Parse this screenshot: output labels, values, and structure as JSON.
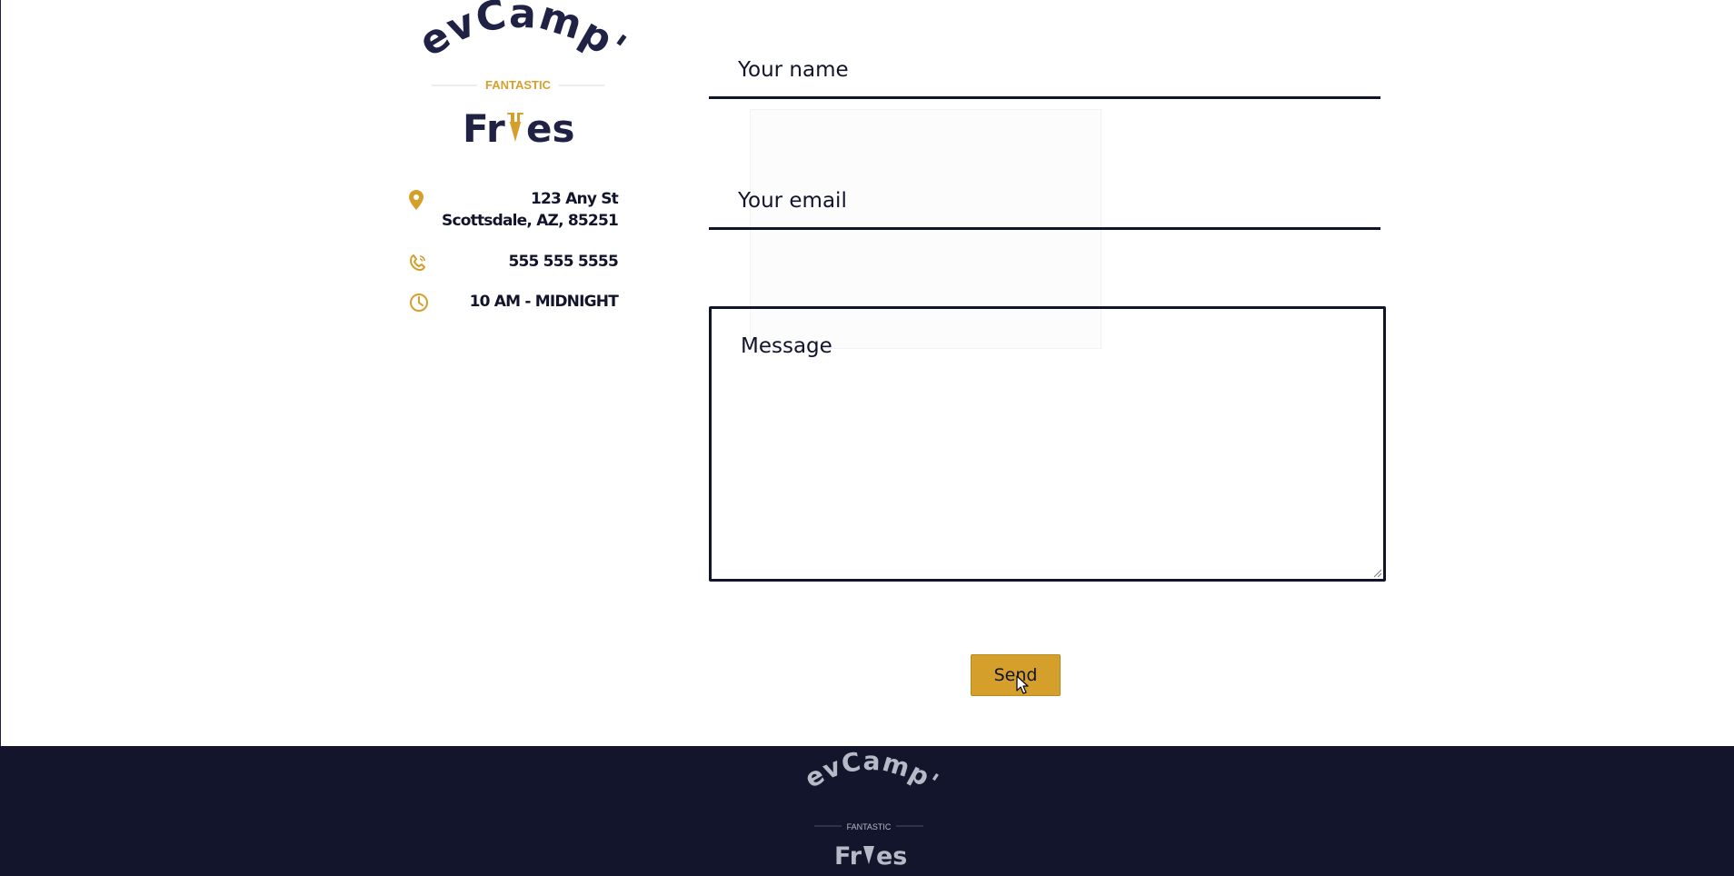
{
  "brand": {
    "name_top": "DevCamp's",
    "tagline": "FANTASTIC",
    "name_bottom_pre": "Fr",
    "name_bottom_post": "es"
  },
  "contact": {
    "address_line1": "123 Any St",
    "address_line2": "Scottsdale, AZ, 85251",
    "phone": "555 555 5555",
    "hours": "10 AM - MIDNIGHT",
    "icons": [
      "map-pin-icon",
      "phone-icon",
      "clock-icon"
    ]
  },
  "form": {
    "name_placeholder": "Your name",
    "email_placeholder": "Your email",
    "message_placeholder": "Message",
    "send_label": "Send"
  },
  "colors": {
    "navy": "#13152d",
    "gold": "#d59f2b",
    "text": "#11142b"
  }
}
